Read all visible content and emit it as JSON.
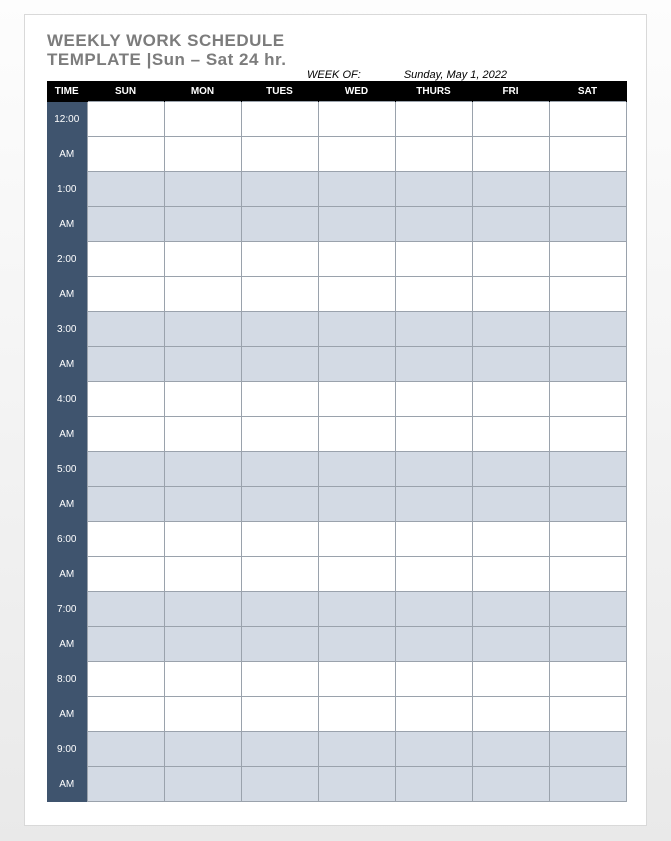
{
  "title": {
    "line1": "WEEKLY WORK SCHEDULE",
    "line2": "TEMPLATE |Sun – Sat 24 hr."
  },
  "week_of": {
    "label": "WEEK OF:",
    "value": "Sunday, May 1, 2022"
  },
  "columns": {
    "time": "TIME",
    "days": [
      "SUN",
      "MON",
      "TUES",
      "WED",
      "THURS",
      "FRI",
      "SAT"
    ]
  },
  "rows": [
    {
      "top": "12:00",
      "bottom": "AM",
      "shade": "white"
    },
    {
      "top": "1:00",
      "bottom": "AM",
      "shade": "blue"
    },
    {
      "top": "2:00",
      "bottom": "AM",
      "shade": "white"
    },
    {
      "top": "3:00",
      "bottom": "AM",
      "shade": "blue"
    },
    {
      "top": "4:00",
      "bottom": "AM",
      "shade": "white"
    },
    {
      "top": "5:00",
      "bottom": "AM",
      "shade": "blue"
    },
    {
      "top": "6:00",
      "bottom": "AM",
      "shade": "white"
    },
    {
      "top": "7:00",
      "bottom": "AM",
      "shade": "blue"
    },
    {
      "top": "8:00",
      "bottom": "AM",
      "shade": "white"
    },
    {
      "top": "9:00",
      "bottom": "AM",
      "shade": "blue"
    }
  ]
}
